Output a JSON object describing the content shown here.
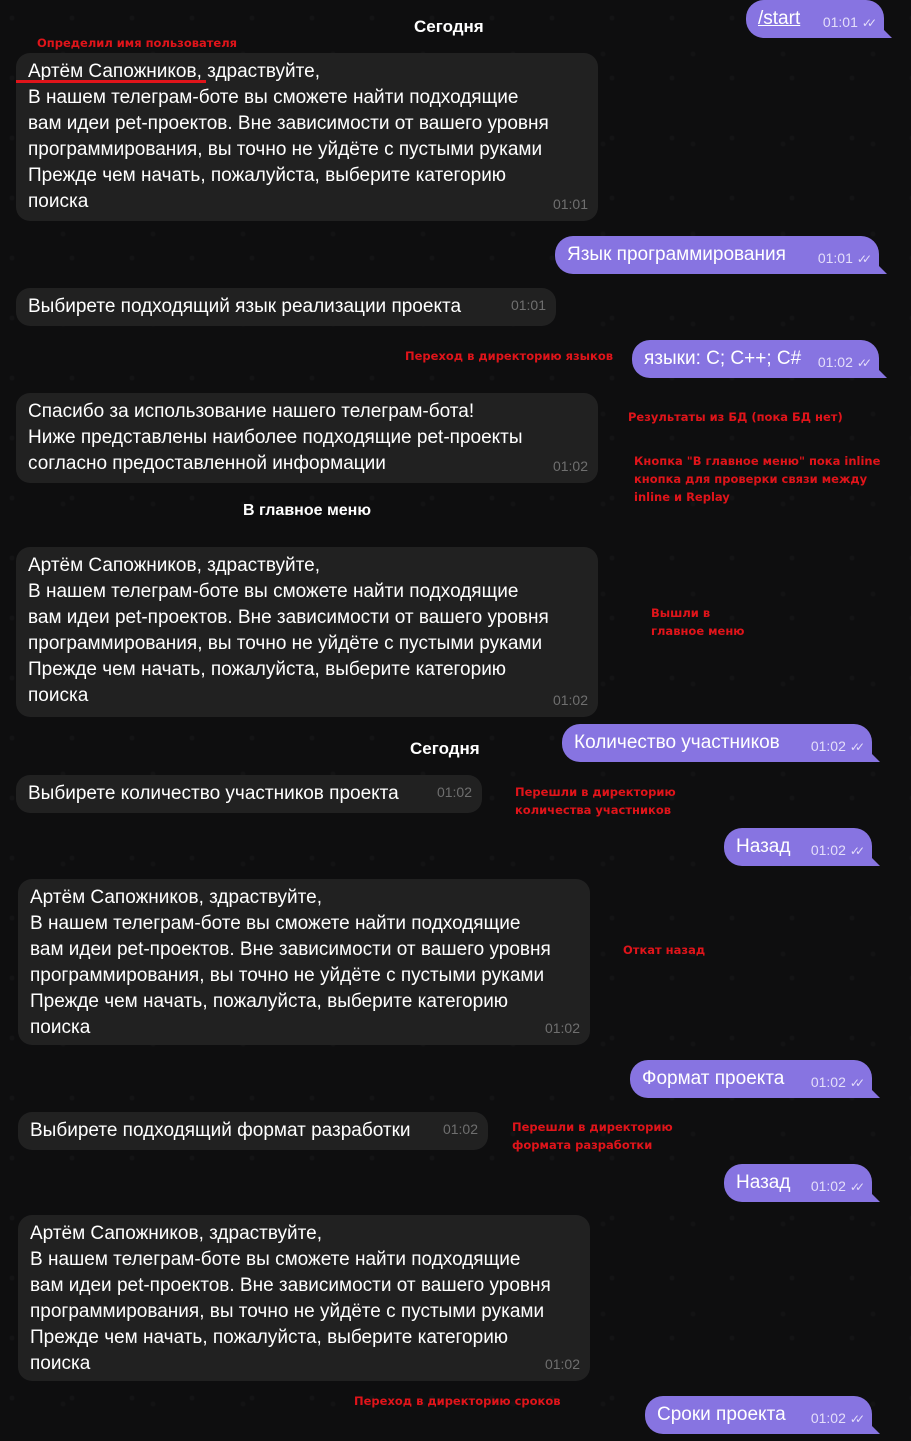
{
  "dates": {
    "today": "Сегодня",
    "main_menu": "В главное меню",
    "today2": "Сегодня"
  },
  "greeting": {
    "name": "Артём Сапожников",
    "lines": [
      ", здраствуйте,",
      "В нашем телеграм-боте вы сможете найти подходящие",
      "вам идеи pet-проектов. Вне зависимости от вашего уровня",
      "программирования, вы точно не уйдёте с пустыми руками",
      "Прежде чем начать, пожалуйста, выберите категорию",
      "поиска"
    ],
    "full_first_line": "Артём Сапожников, здраствуйте,"
  },
  "outgoing": [
    {
      "text": "/start",
      "time": "01:01"
    },
    {
      "text": "Язык программирования",
      "time": "01:01"
    },
    {
      "text": "языки: C; C++; C#",
      "time": "01:02"
    },
    {
      "text": "Количество участников",
      "time": "01:02"
    },
    {
      "text": "Назад",
      "time": "01:02"
    },
    {
      "text": "Формат проекта",
      "time": "01:02"
    },
    {
      "text": "Назад",
      "time": "01:02"
    },
    {
      "text": "Сроки проекта",
      "time": "01:02"
    }
  ],
  "incoming": {
    "greet1_time": "01:01",
    "choose_lang": {
      "text": "Выбирете подходящий язык реализации проекта",
      "time": "01:01"
    },
    "thanks": {
      "lines": [
        "Спасибо за использование нашего телеграм-бота!",
        "Ниже представлены наиболее подходящие pet-проекты",
        "согласно предоставленной информации"
      ],
      "time": "01:02"
    },
    "greet2_time": "01:02",
    "choose_count": {
      "text": "Выбирете количество участников проекта",
      "time": "01:02"
    },
    "greet3_time": "01:02",
    "choose_format": {
      "text": "Выбирете подходящий формат разработки",
      "time": "01:02"
    },
    "greet4_time": "01:02"
  },
  "ticks": "✓✓",
  "notes": {
    "username": "Определил имя пользователя",
    "lang_dir": "Переход в директорию языков",
    "db_results": "Результаты из БД (пока БД нет)",
    "inline_btn": [
      "Кнопка \"В главное меню\" пока inline",
      "кнопка для проверки связи между",
      "inline и Replay"
    ],
    "main_menu": [
      "Вышли в",
      "главное меню"
    ],
    "count_dir": [
      "Перешли в директорию",
      "количества участников"
    ],
    "rollback": "Откат назад",
    "format_dir": [
      "Перешли в директорию",
      "формата разработки"
    ],
    "deadline_dir": "Переход в директорию сроков"
  },
  "colors": {
    "outgoing": "#8774e1",
    "incoming": "#212121",
    "note": "#e0141a",
    "background": "#0e0e0f"
  }
}
